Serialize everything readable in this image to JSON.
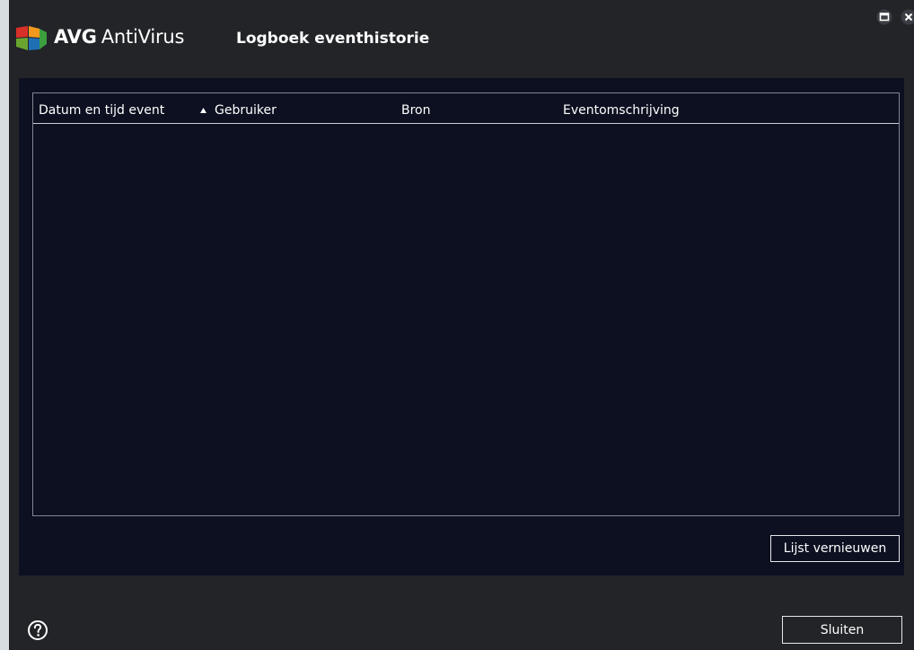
{
  "app": {
    "brand_avg": "AVG",
    "brand_product": "AntiVirus",
    "dialog_title": "Logboek eventhistorie"
  },
  "window_controls": [
    {
      "name": "maximize",
      "icon": "maximize-icon"
    },
    {
      "name": "close",
      "icon": "close-icon"
    }
  ],
  "table": {
    "columns": [
      "Datum en tijd event",
      "Gebruiker",
      "Bron",
      "Eventomschrijving"
    ],
    "sort_indicator_icon": "sort-ascending-icon",
    "rows": []
  },
  "buttons": {
    "refresh_label": "Lijst vernieuwen",
    "close_label": "Sluiten"
  },
  "footer": {
    "help_icon": "help-icon"
  },
  "colors": {
    "window_bg": "#222428",
    "panel_bg": "#0c1020",
    "text": "#ffffff",
    "logo_red": "#d9302a",
    "logo_orange": "#f39a1e",
    "logo_green": "#6aa62f",
    "logo_blue": "#1f6fb4"
  }
}
